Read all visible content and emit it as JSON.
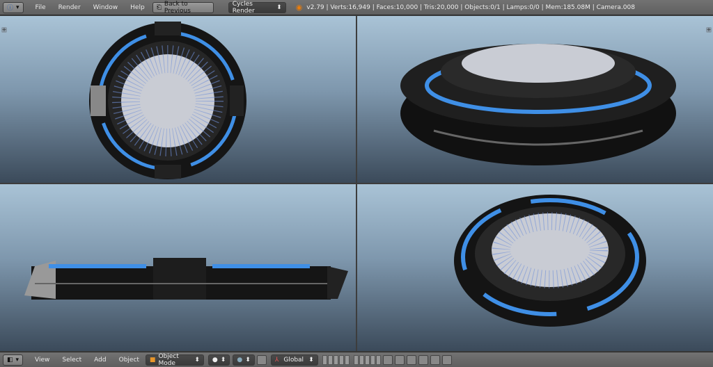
{
  "top_bar": {
    "editor_type_icon": "info-icon",
    "menus": [
      "File",
      "Render",
      "Window",
      "Help"
    ],
    "back_button": "Back to Previous",
    "render_engine": "Cycles Render",
    "logo_icon": "blender-logo-icon",
    "stats": "v2.79 | Verts:16,949 | Faces:10,000 | Tris:20,000 | Objects:0/1 | Lamps:0/0 | Mem:185.08M | Camera.008"
  },
  "bottom_bar": {
    "editor_type_icon": "3d-view-icon",
    "menus": [
      "View",
      "Select",
      "Add",
      "Object"
    ],
    "mode": "Object Mode",
    "shading_icon": "solid-sphere-icon",
    "pivot_icon": "pivot-icon",
    "orientation": "Global"
  },
  "colors": {
    "accent_blue": "#3f8fe6",
    "body_black": "#1a1a1a",
    "plate": "#c9ccd4"
  }
}
